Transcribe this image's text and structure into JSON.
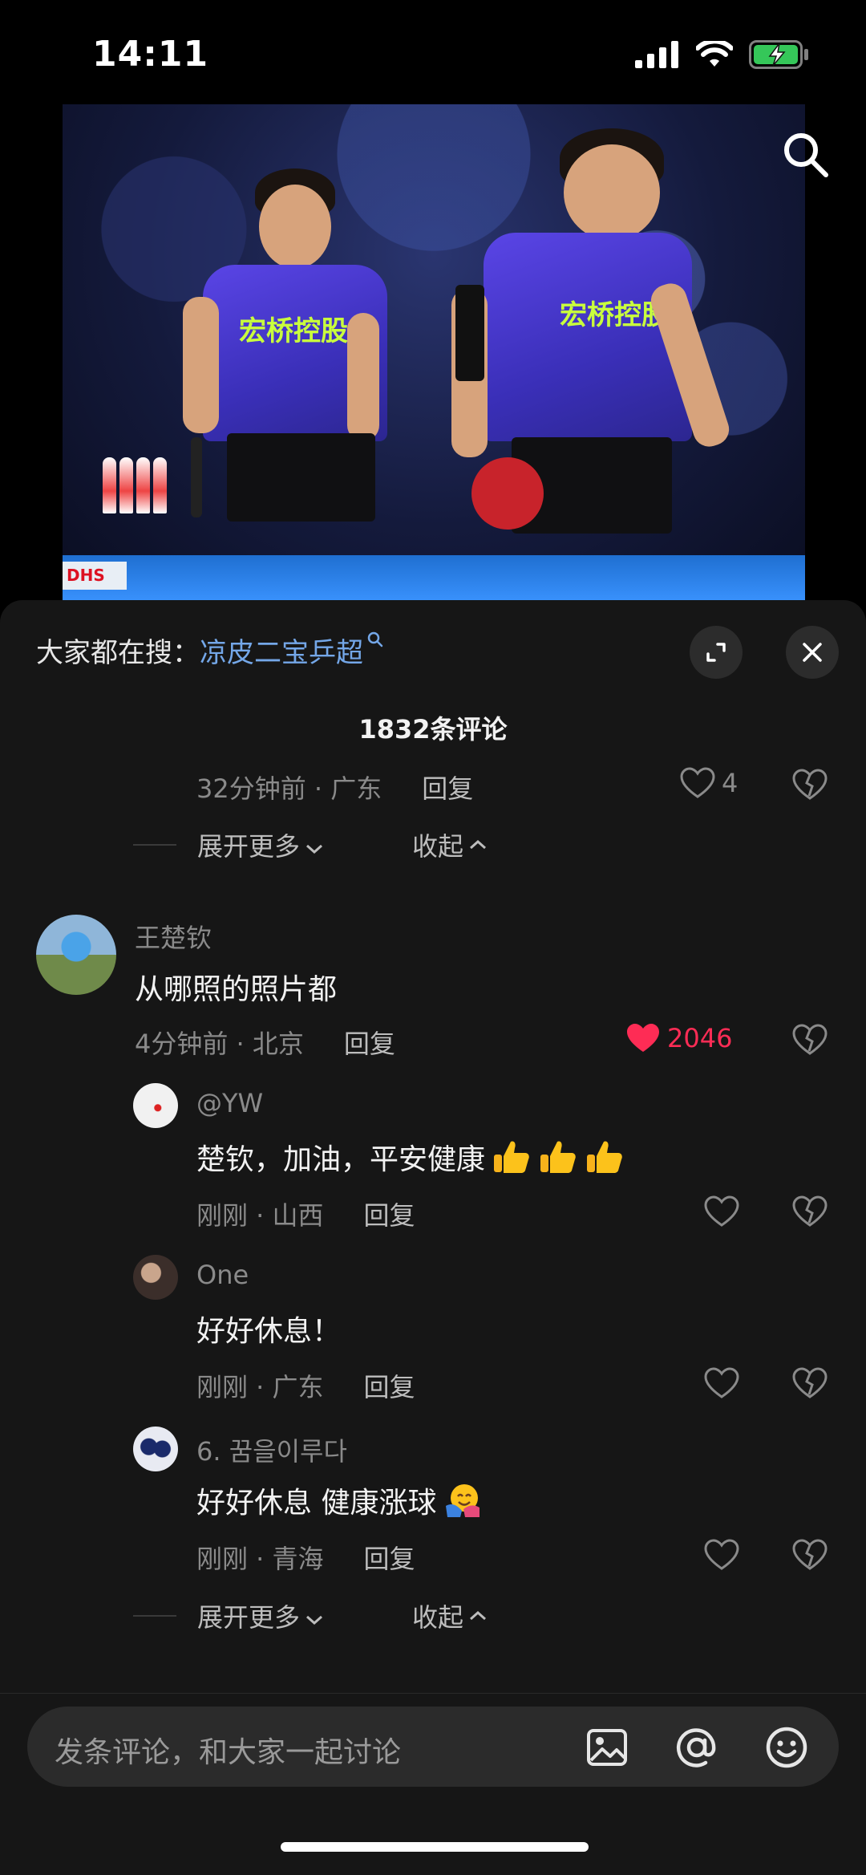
{
  "status_bar": {
    "time": "14:11"
  },
  "video": {
    "jersey_text_1": "宏桥控股",
    "jersey_text_2": "宏桥控股",
    "board_text": "DHS"
  },
  "sheet": {
    "hot_search_prefix": "大家都在搜：",
    "hot_search_keyword": "凉皮二宝乒超",
    "comment_count_title": "1832条评论"
  },
  "top_reply": {
    "meta": "32分钟前 · 广东",
    "reply_label": "回复",
    "like_count": "4"
  },
  "top_expand": {
    "expand_label": "展开更多",
    "collapse_label": "收起"
  },
  "main_comment": {
    "username": "王楚钦",
    "text": "从哪照的照片都",
    "meta": "4分钟前 · 北京",
    "reply_label": "回复",
    "like_count": "2046"
  },
  "replies": [
    {
      "username": "@YW",
      "text": "楚钦，加油，平安健康",
      "meta": "刚刚 · 山西",
      "reply_label": "回复"
    },
    {
      "username": "One",
      "text": "好好休息！",
      "meta": "刚刚 · 广东",
      "reply_label": "回复"
    },
    {
      "username": "6. 꿈을이루다",
      "text": "好好休息  健康涨球",
      "meta": "刚刚 · 青海",
      "reply_label": "回复"
    }
  ],
  "bottom_expand": {
    "expand_label": "展开更多",
    "collapse_label": "收起"
  },
  "input": {
    "placeholder": "发条评论，和大家一起讨论"
  },
  "colors": {
    "like_red": "#fe2c55",
    "link_blue": "#74a7e8",
    "sheet_bg": "#161616"
  }
}
